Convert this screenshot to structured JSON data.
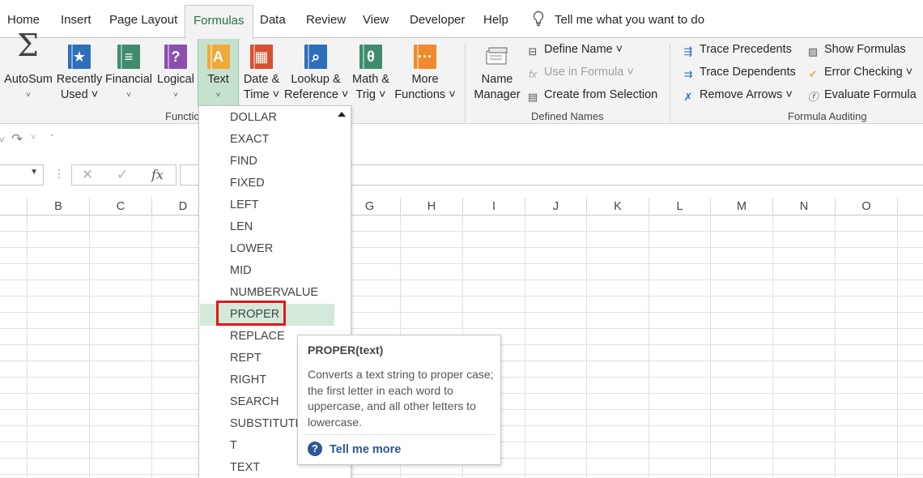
{
  "tabs": [
    {
      "label": "Home",
      "active": false
    },
    {
      "label": "Insert",
      "active": false
    },
    {
      "label": "Page Layout",
      "active": false
    },
    {
      "label": "Formulas",
      "active": true
    },
    {
      "label": "Data",
      "active": false
    },
    {
      "label": "Review",
      "active": false
    },
    {
      "label": "View",
      "active": false
    },
    {
      "label": "Developer",
      "active": false
    },
    {
      "label": "Help",
      "active": false
    }
  ],
  "tell_me": "Tell me what you want to do",
  "function_library": {
    "autosum": {
      "line1": "AutoSum",
      "line2": "˅"
    },
    "recently_used": {
      "line1": "Recently",
      "line2": "Used ˅"
    },
    "financial": {
      "line1": "Financial",
      "line2": "˅"
    },
    "logical": {
      "line1": "Logical",
      "line2": "˅"
    },
    "text": {
      "line1": "Text",
      "line2": "˅"
    },
    "date_time": {
      "line1": "Date &",
      "line2": "Time ˅"
    },
    "lookup_ref": {
      "line1": "Lookup &",
      "line2": "Reference ˅"
    },
    "math_trig": {
      "line1": "Math &",
      "line2": "Trig ˅"
    },
    "more_functions": {
      "line1": "More",
      "line2": "Functions ˅"
    },
    "group_label": "Functio"
  },
  "defined_names": {
    "name_manager": {
      "line1": "Name",
      "line2": "Manager"
    },
    "define_name": "Define Name ˅",
    "use_in_formula": "Use in Formula ˅",
    "create_from_selection": "Create from Selection",
    "group_label": "Defined Names"
  },
  "formula_auditing": {
    "trace_precedents": "Trace Precedents",
    "trace_dependents": "Trace Dependents",
    "remove_arrows": "Remove Arrows ˅",
    "show_formulas": "Show Formulas",
    "error_checking": "Error Checking ˅",
    "evaluate_formula": "Evaluate Formula",
    "group_label": "Formula Auditing"
  },
  "formula_bar": {
    "fx": "fx",
    "cancel": "✕",
    "enter": "✓"
  },
  "columns": [
    "B",
    "C",
    "D",
    "G",
    "H",
    "I",
    "J",
    "K",
    "L",
    "M",
    "N",
    "O"
  ],
  "text_functions": [
    "DOLLAR",
    "EXACT",
    "FIND",
    "FIXED",
    "LEFT",
    "LEN",
    "LOWER",
    "MID",
    "NUMBERVALUE",
    "PROPER",
    "REPLACE",
    "REPT",
    "RIGHT",
    "SEARCH",
    "SUBSTITUTE",
    "T",
    "TEXT"
  ],
  "highlighted_function": "PROPER",
  "tooltip": {
    "title": "PROPER(text)",
    "description": "Converts a text string to proper case; the first letter in each word to uppercase, and all other letters to lowercase.",
    "link": "Tell me more"
  },
  "colors": {
    "accent": "#217346",
    "highlight": "#d3eadb",
    "callout": "#e8141b",
    "link": "#2b5797"
  }
}
